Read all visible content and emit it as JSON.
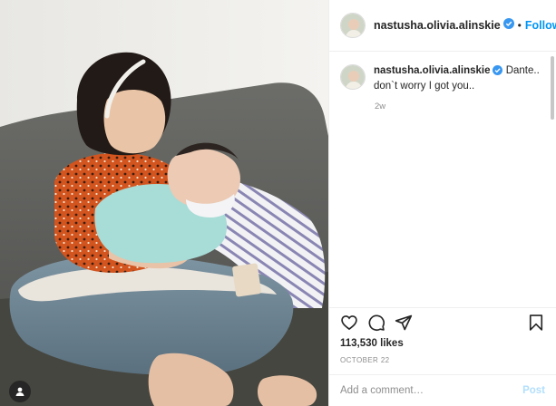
{
  "header": {
    "username": "nastusha.olivia.alinskie",
    "separator": "•",
    "follow_label": "Follow"
  },
  "caption": {
    "username": "nastusha.olivia.alinskie",
    "text": "Dante.. don`t worry I got you..",
    "time": "2w"
  },
  "actions": {
    "icons": [
      "heart-icon",
      "comment-icon",
      "share-icon",
      "bookmark-icon"
    ]
  },
  "likes": {
    "count": "113,530",
    "label": "likes"
  },
  "date": "OCTOBER 22",
  "comment_box": {
    "placeholder": "Add a comment…",
    "post_label": "Post"
  },
  "colors": {
    "accent": "#0095f6",
    "verified": "#3897f0",
    "post_disabled": "#b2dffc",
    "muted": "#8e8e8e"
  }
}
